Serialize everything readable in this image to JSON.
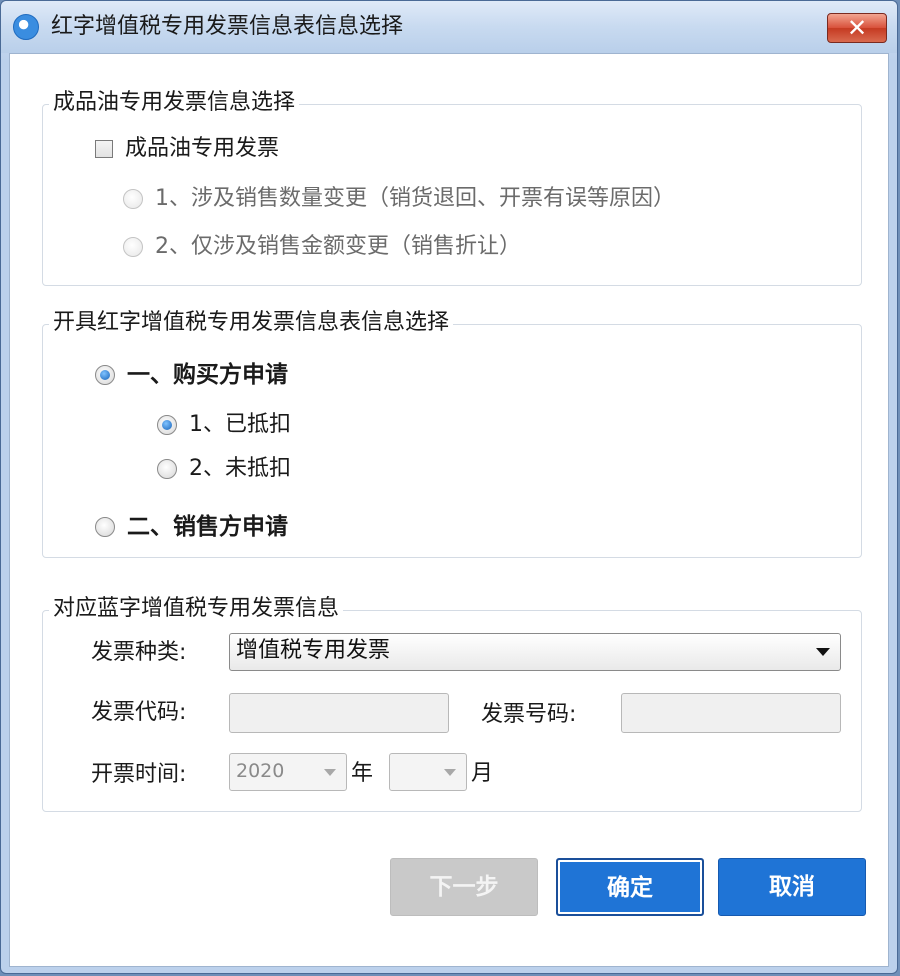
{
  "window": {
    "title": "红字增值税专用发票信息表信息选择",
    "close_label": "✕"
  },
  "oil_section": {
    "legend": "成品油专用发票信息选择",
    "checkbox_label": "成品油专用发票",
    "checkbox_checked": false,
    "options": [
      {
        "label": "1、涉及销售数量变更（销货退回、开票有误等原因）",
        "checked": false,
        "disabled": true
      },
      {
        "label": "2、仅涉及销售金额变更（销售折让）",
        "checked": false,
        "disabled": true
      }
    ]
  },
  "red_section": {
    "legend": "开具红字增值税专用发票信息表信息选择",
    "buyer_label": "一、购买方申请",
    "buyer_checked": true,
    "buyer_options": [
      {
        "label": "1、已抵扣",
        "checked": true
      },
      {
        "label": "2、未抵扣",
        "checked": false
      }
    ],
    "seller_label": "二、销售方申请",
    "seller_checked": false
  },
  "blue_section": {
    "legend": "对应蓝字增值税专用发票信息",
    "invoice_type_label": "发票种类:",
    "invoice_type_value": "增值税专用发票",
    "invoice_code_label": "发票代码:",
    "invoice_code_value": "",
    "invoice_number_label": "发票号码:",
    "invoice_number_value": "",
    "issue_time_label": "开票时间:",
    "year_value": "2020",
    "year_unit": "年",
    "month_value": "",
    "month_unit": "月"
  },
  "buttons": {
    "next": "下一步",
    "confirm": "确定",
    "cancel": "取消"
  }
}
